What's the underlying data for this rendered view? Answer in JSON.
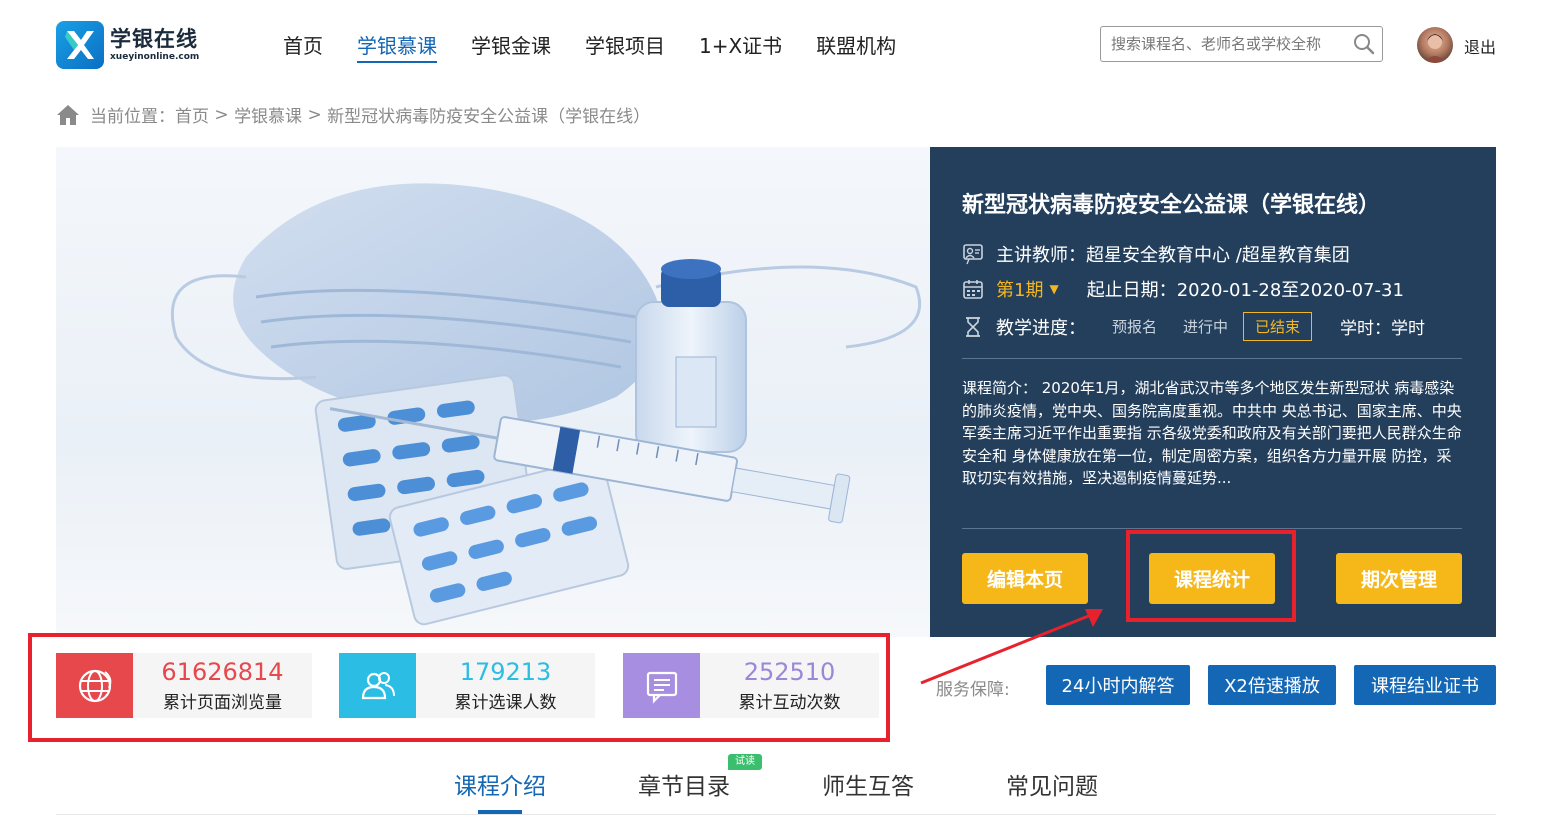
{
  "header": {
    "logo_cn": "学银在线",
    "logo_en": "xueyinonline.com",
    "nav": [
      {
        "label": "首页",
        "active": false
      },
      {
        "label": "学银慕课",
        "active": true
      },
      {
        "label": "学银金课",
        "active": false
      },
      {
        "label": "学银项目",
        "active": false
      },
      {
        "label": "1+X证书",
        "active": false
      },
      {
        "label": "联盟机构",
        "active": false
      }
    ],
    "search_placeholder": "搜索课程名、老师名或学校全称",
    "logout_label": "退出"
  },
  "breadcrumb": {
    "prefix": "当前位置：",
    "items": [
      "首页",
      "学银慕课",
      "新型冠状病毒防疫安全公益课（学银在线）"
    ],
    "separator": " > "
  },
  "course": {
    "title": "新型冠状病毒防疫安全公益课（学银在线）",
    "teacher_label": "主讲教师：",
    "teacher": "超星安全教育中心 /超星教育集团",
    "period": "第1期",
    "date_label": "起止日期：",
    "date_range": "2020-01-28至2020-07-31",
    "progress_label": "教学进度：",
    "stages": [
      "预报名",
      "进行中",
      "已结束"
    ],
    "current_stage": "已结束",
    "hours_label": "学时：学时",
    "description": "课程简介： 2020年1月，湖北省武汉市等多个地区发生新型冠状 病毒感染的肺炎疫情，党中央、国务院高度重视。中共中 央总书记、国家主席、中央军委主席习近平作出重要指 示各级党委和政府及有关部门要把人民群众生命安全和 身体健康放在第一位，制定周密方案，组织各方力量开展 防控，采取切实有效措施，坚决遏制疫情蔓延势...",
    "buttons": {
      "edit": "编辑本页",
      "stats": "课程统计",
      "periods": "期次管理"
    }
  },
  "stats": [
    {
      "value": "61626814",
      "label": "累计页面浏览量",
      "color": "#e6484c",
      "value_color": "#e6484c"
    },
    {
      "value": "179213",
      "label": "累计选课人数",
      "color": "#2bbde3",
      "value_color": "#2bbde3"
    },
    {
      "value": "252510",
      "label": "累计互动次数",
      "color": "#a78ee0",
      "value_color": "#9b86d8"
    }
  ],
  "service": {
    "label": "服务保障:",
    "items": [
      "24小时内解答",
      "X2倍速播放",
      "课程结业证书"
    ]
  },
  "tabs": {
    "items": [
      "课程介绍",
      "章节目录",
      "师生互答",
      "常见问题"
    ],
    "active": "课程介绍",
    "trial_badge": "试读"
  },
  "colors": {
    "brand_blue": "#1467b4",
    "panel_bg": "#233f5c",
    "accent_yellow": "#f6b718",
    "annotation_red": "#e8222c"
  }
}
